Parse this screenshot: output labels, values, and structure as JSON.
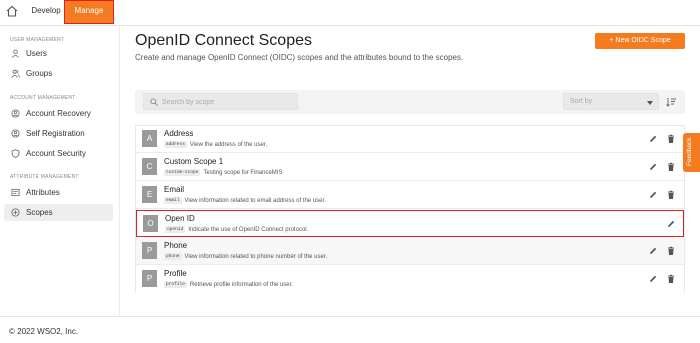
{
  "nav_tabs": {
    "develop": "Develop",
    "manage": "Manage"
  },
  "sidebar": {
    "sections": [
      {
        "title": "USER MANAGEMENT",
        "items": [
          {
            "label": "Users",
            "icon": "user-icon"
          },
          {
            "label": "Groups",
            "icon": "groups-icon"
          }
        ]
      },
      {
        "title": "ACCOUNT MANAGEMENT",
        "items": [
          {
            "label": "Account Recovery",
            "icon": "account-recovery-icon"
          },
          {
            "label": "Self Registration",
            "icon": "self-registration-icon"
          },
          {
            "label": "Account Security",
            "icon": "shield-icon"
          }
        ]
      },
      {
        "title": "ATTRIBUTE MANAGEMENT",
        "items": [
          {
            "label": "Attributes",
            "icon": "attributes-icon"
          },
          {
            "label": "Scopes",
            "icon": "scopes-icon",
            "active": true
          }
        ]
      }
    ]
  },
  "page": {
    "title": "OpenID Connect Scopes",
    "description": "Create and manage OpenID Connect (OIDC) scopes and the attributes bound to the scopes.",
    "new_button": "+ New OIDC Scope"
  },
  "filters": {
    "search_placeholder": "Search by scope",
    "sort_placeholder": "Sort by"
  },
  "scopes": [
    {
      "initial": "A",
      "name": "Address",
      "code": "address",
      "description": "View the address of the user."
    },
    {
      "initial": "C",
      "name": "Custom Scope 1",
      "code": "custom-scope",
      "description": "Testing scope for FinanceMIS"
    },
    {
      "initial": "E",
      "name": "Email",
      "code": "email",
      "description": "View information related to email address of the user."
    },
    {
      "initial": "O",
      "name": "Open ID",
      "code": "openid",
      "description": "Indicate the use of OpenID Connect protocol."
    },
    {
      "initial": "P",
      "name": "Phone",
      "code": "phone",
      "description": "View information related to phone number of the user."
    },
    {
      "initial": "P",
      "name": "Profile",
      "code": "profile",
      "description": "Retrieve profile information of the user."
    }
  ],
  "feedback_label": "Feedback",
  "footer": {
    "copyright": "© 2022 WSO2, Inc."
  },
  "colors": {
    "accent": "#f47b20",
    "highlight_border": "#e02020"
  }
}
